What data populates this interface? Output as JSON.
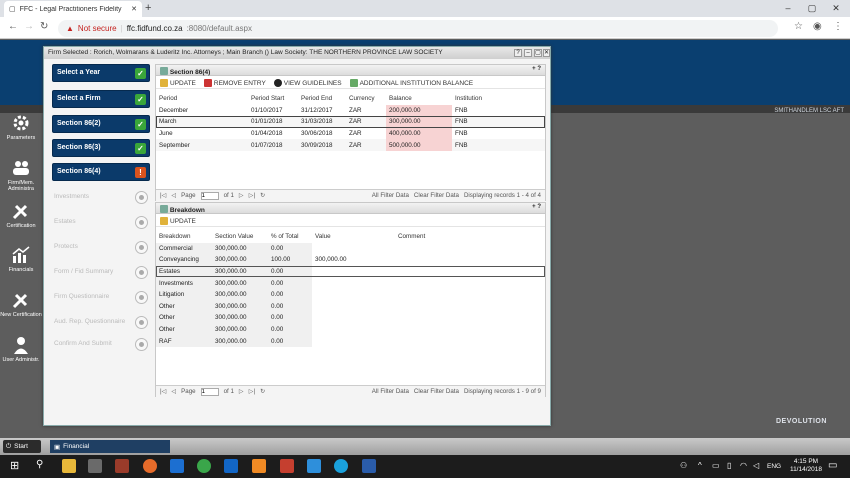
{
  "browser": {
    "tab_title": "FFC - Legal Practitioners Fidelity",
    "url_warning": "Not secure",
    "url_host": "ffc.fidfund.co.za",
    "url_path": ":8080/default.aspx"
  },
  "header": {
    "user": "SMITHANDLEM LSC AFT"
  },
  "rail": [
    {
      "label": "Parameters",
      "icon": "gear-icon"
    },
    {
      "label": "Firm/Mem. Administra",
      "icon": "people-icon"
    },
    {
      "label": "Certification",
      "icon": "tools-icon"
    },
    {
      "label": "Financials",
      "icon": "chart-icon"
    },
    {
      "label": "New Certification",
      "icon": "tools-icon"
    },
    {
      "label": "User Administr.",
      "icon": "user-icon"
    }
  ],
  "dialog": {
    "title": "Firm Selected : Rorich, Wolmarans & Luderitz Inc. Attorneys ; Main Branch () Law Society: THE NORTHERN PROVINCE LAW SOCIETY"
  },
  "steps_active": [
    {
      "label": "Select a Year",
      "state": "ok"
    },
    {
      "label": "Select a Firm",
      "state": "ok"
    },
    {
      "label": "Section 86(2)",
      "state": "ok"
    },
    {
      "label": "Section 86(3)",
      "state": "ok"
    },
    {
      "label": "Section 86(4)",
      "state": "warn"
    }
  ],
  "steps_inactive": [
    "Investments",
    "Estates",
    "Protects",
    "Form / Fid Summary",
    "Firm Questionnaire",
    "Aud. Rep. Questionnaire",
    "Confirm And Submit"
  ],
  "section": {
    "title": "Section 86(4)",
    "toolbar": {
      "update": "UPDATE",
      "remove": "REMOVE ENTRY",
      "guidelines": "VIEW GUIDELINES",
      "additional": "ADDITIONAL INSTITUTION BALANCE"
    },
    "columns": [
      "Period",
      "Period Start",
      "Period End",
      "Currency",
      "Balance",
      "Institution"
    ],
    "rows": [
      [
        "December",
        "01/10/2017",
        "31/12/2017",
        "ZAR",
        "200,000.00",
        "FNB"
      ],
      [
        "March",
        "01/01/2018",
        "31/03/2018",
        "ZAR",
        "300,000.00",
        "FNB"
      ],
      [
        "June",
        "01/04/2018",
        "30/06/2018",
        "ZAR",
        "400,000.00",
        "FNB"
      ],
      [
        "September",
        "01/07/2018",
        "30/09/2018",
        "ZAR",
        "500,000.00",
        "FNB"
      ]
    ],
    "pager": {
      "page": "Page",
      "page_value": "1",
      "of": "of 1",
      "all_filter": "All Filter Data",
      "clear_filter": "Clear Filter Data",
      "display": "Displaying records 1 - 4 of 4"
    }
  },
  "breakdown": {
    "title": "Breakdown",
    "update": "UPDATE",
    "columns": [
      "Breakdown",
      "Section Value",
      "% of Total",
      "Value",
      "Comment"
    ],
    "rows": [
      [
        "Commercial",
        "300,000.00",
        "0.00",
        "",
        ""
      ],
      [
        "Conveyancing",
        "300,000.00",
        "100.00",
        "300,000.00",
        ""
      ],
      [
        "Estates",
        "300,000.00",
        "0.00",
        "",
        ""
      ],
      [
        "Investments",
        "300,000.00",
        "0.00",
        "",
        ""
      ],
      [
        "Litigation",
        "300,000.00",
        "0.00",
        "",
        ""
      ],
      [
        "Other",
        "300,000.00",
        "0.00",
        "",
        ""
      ],
      [
        "Other",
        "300,000.00",
        "0.00",
        "",
        ""
      ],
      [
        "Other",
        "300,000.00",
        "0.00",
        "",
        ""
      ],
      [
        "RAF",
        "300,000.00",
        "0.00",
        "",
        ""
      ]
    ],
    "pager": {
      "page": "Page",
      "page_value": "1",
      "of": "of 1",
      "all_filter": "All Filter Data",
      "clear_filter": "Clear Filter Data",
      "display": "Displaying records 1 - 9 of 9"
    }
  },
  "dock": {
    "start": "Start",
    "financial": "Financial"
  },
  "brand": "DEVOLUTION",
  "taskbar": {
    "lang": "ENG",
    "time": "4:15 PM",
    "date": "11/14/2018"
  },
  "colors": {
    "navy": "#0a3f70",
    "ok": "#3aa63a",
    "warn": "#d9531e",
    "balance_bg": "#f7d3d3"
  }
}
